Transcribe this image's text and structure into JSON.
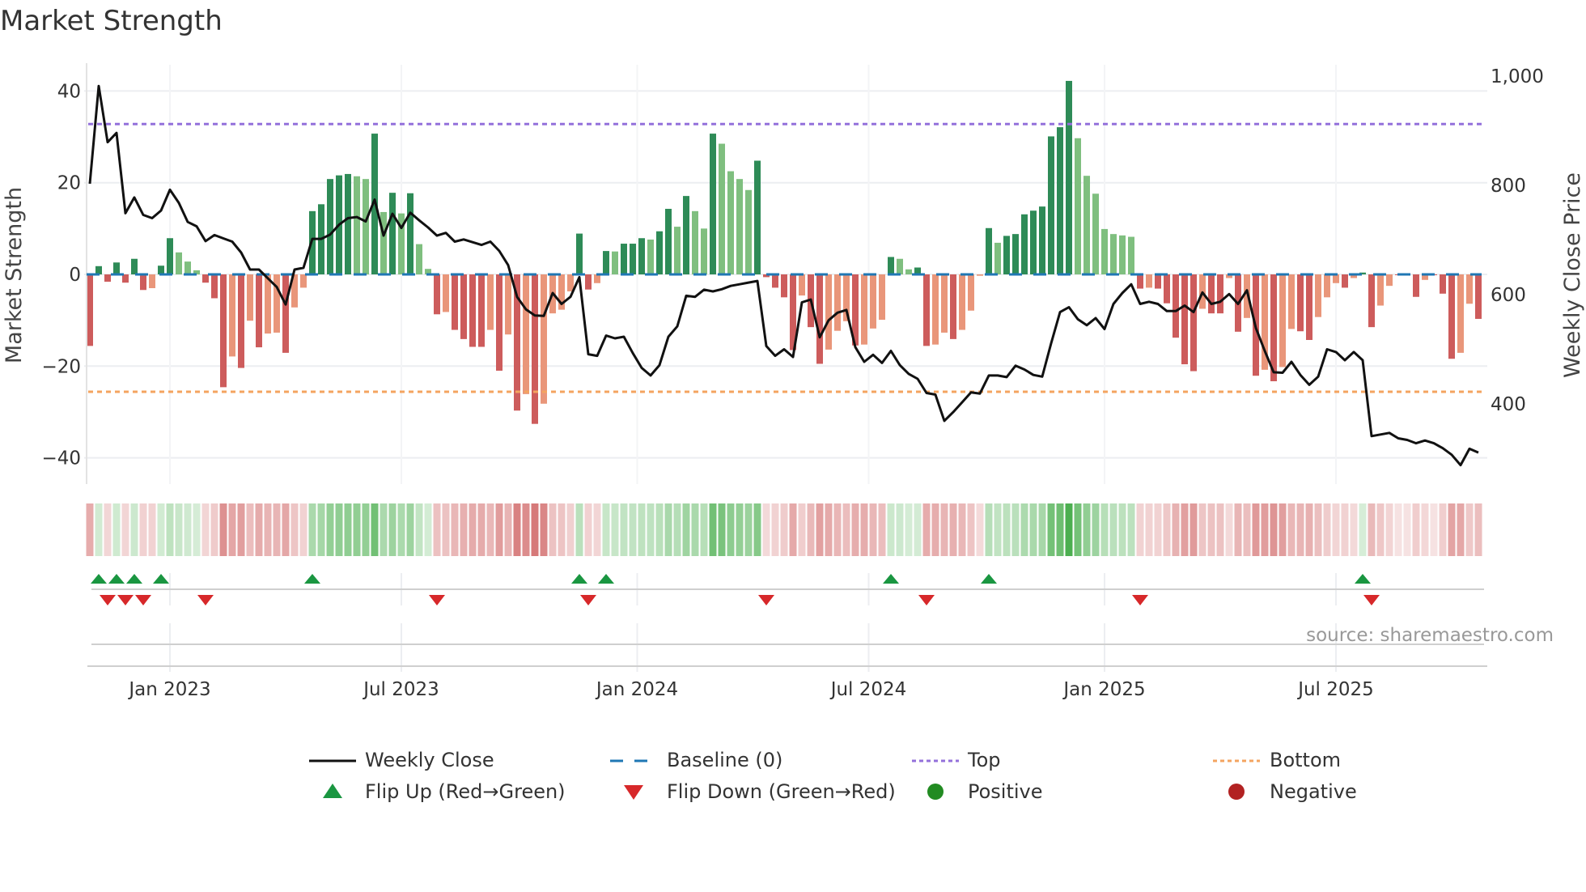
{
  "title": "Market Strength",
  "source": "source: sharemaestro.com",
  "legend": {
    "weekly_close": "Weekly Close",
    "baseline": "Baseline (0)",
    "top": "Top",
    "bottom": "Bottom",
    "flip_up": "Flip Up (Red→Green)",
    "flip_down": "Flip Down (Green→Red)",
    "positive": "Positive",
    "negative": "Negative"
  },
  "colors": {
    "pos_dark": "#2e8b57",
    "pos_light": "#7fbf7f",
    "neg_dark": "#cd5c5c",
    "neg_light": "#e9967a",
    "line": "#111111",
    "baseline": "#1f77b4",
    "top": "#9370db",
    "bottom": "#f4a460",
    "flip_up": "#1a9641",
    "flip_down": "#d7282a",
    "positive": "#228b22",
    "negative": "#b22222"
  },
  "chart_data": {
    "type": "bar",
    "title": "Market Strength",
    "ylabel": "Market Strength",
    "y2label": "Weekly Close Price",
    "ylim": [
      -45,
      46
    ],
    "y2lim": [
      270,
      1010
    ],
    "yticks": [
      40,
      20,
      0,
      -20,
      -40
    ],
    "ytick_labels": [
      "40",
      "20",
      "0",
      "−20",
      "−40"
    ],
    "y2ticks": [
      1000,
      800,
      600,
      400
    ],
    "y2tick_labels": [
      "1,000",
      "800",
      "600",
      "400"
    ],
    "xtick_labels": [
      "Jan 2023",
      "Jul 2023",
      "Jan 2024",
      "Jul 2024",
      "Jan 2025",
      "Jul 2025"
    ],
    "xtick_week_index": [
      9,
      35,
      61.5,
      87.5,
      114,
      140
    ],
    "top_level": 32.8,
    "bottom_level": -25.6,
    "baseline": 0,
    "strength": [
      -15.6,
      1.8,
      -1.6,
      2.6,
      -1.8,
      3.4,
      -3.4,
      -3.0,
      1.9,
      7.9,
      4.8,
      2.8,
      0.9,
      -1.8,
      -5.2,
      -24.6,
      -17.9,
      -20.4,
      -10.1,
      -15.9,
      -12.9,
      -12.7,
      -17.1,
      -7.2,
      -2.9,
      13.8,
      15.3,
      20.8,
      21.6,
      21.9,
      21.4,
      20.8,
      30.7,
      13.6,
      17.8,
      13.3,
      17.7,
      6.6,
      1.2,
      -8.7,
      -8.2,
      -12.1,
      -14.1,
      -15.8,
      -15.8,
      -12.1,
      -21.0,
      -13.1,
      -29.7,
      -26.1,
      -32.6,
      -28.2,
      -8.5,
      -7.7,
      -3.7,
      8.9,
      -3.3,
      -1.9,
      5.1,
      5.0,
      6.7,
      6.7,
      7.9,
      7.6,
      9.4,
      14.3,
      10.4,
      17.1,
      13.8,
      10.0,
      30.7,
      28.5,
      22.5,
      20.8,
      18.4,
      24.8,
      -0.6,
      -2.9,
      -5.0,
      -16.5,
      -4.6,
      -11.5,
      -19.5,
      -16.4,
      -12.3,
      -10.2,
      -15.5,
      -15.3,
      -11.8,
      -9.9,
      3.8,
      3.4,
      1.1,
      1.5,
      -15.6,
      -15.3,
      -12.7,
      -14.1,
      -12.1,
      -7.9,
      -0.3,
      10.1,
      6.9,
      8.4,
      8.8,
      13.1,
      13.9,
      14.8,
      30.1,
      32.1,
      42.2,
      29.7,
      21.5,
      17.6,
      9.9,
      8.8,
      8.5,
      8.2,
      -3.1,
      -2.9,
      -3.1,
      -6.3,
      -13.8,
      -19.6,
      -21.1,
      -7.5,
      -8.5,
      -8.5,
      -0.8,
      -12.5,
      -9.5,
      -22.1,
      -20.8,
      -23.3,
      -20.2,
      -11.9,
      -12.4,
      -14.3,
      -9.3,
      -5.0,
      -1.9,
      -2.9,
      -0.8,
      0.4,
      -11.5,
      -6.8,
      -2.5,
      0,
      0,
      -4.9,
      -1.2,
      0,
      -4.2,
      -18.4,
      -17.1,
      -6.4,
      -9.7
    ],
    "weekly_close": [
      803,
      982,
      879,
      896,
      749,
      778,
      746,
      740,
      754,
      792,
      768,
      733,
      725,
      698,
      709,
      703,
      697,
      677,
      646,
      646,
      630,
      614,
      582,
      646,
      649,
      702,
      702,
      710,
      728,
      740,
      742,
      734,
      774,
      708,
      748,
      722,
      750,
      736,
      723,
      708,
      713,
      697,
      701,
      696,
      691,
      697,
      680,
      654,
      596,
      573,
      562,
      561,
      603,
      583,
      596,
      632,
      491,
      488,
      525,
      520,
      523,
      493,
      466,
      452,
      471,
      523,
      542,
      598,
      596,
      609,
      606,
      610,
      616,
      619,
      622,
      625,
      506,
      488,
      500,
      486,
      586,
      591,
      522,
      553,
      567,
      572,
      504,
      477,
      490,
      475,
      497,
      471,
      455,
      446,
      420,
      417,
      369,
      385,
      403,
      421,
      419,
      452,
      452,
      449,
      470,
      463,
      453,
      450,
      511,
      568,
      577,
      555,
      544,
      557,
      537,
      583,
      603,
      619,
      583,
      587,
      583,
      570,
      570,
      580,
      568,
      604,
      583,
      587,
      601,
      583,
      608,
      539,
      497,
      458,
      457,
      477,
      453,
      435,
      450,
      500,
      495,
      480,
      495,
      480,
      341,
      344,
      347,
      337,
      334,
      328,
      333,
      328,
      319,
      307,
      288,
      318,
      311
    ]
  }
}
